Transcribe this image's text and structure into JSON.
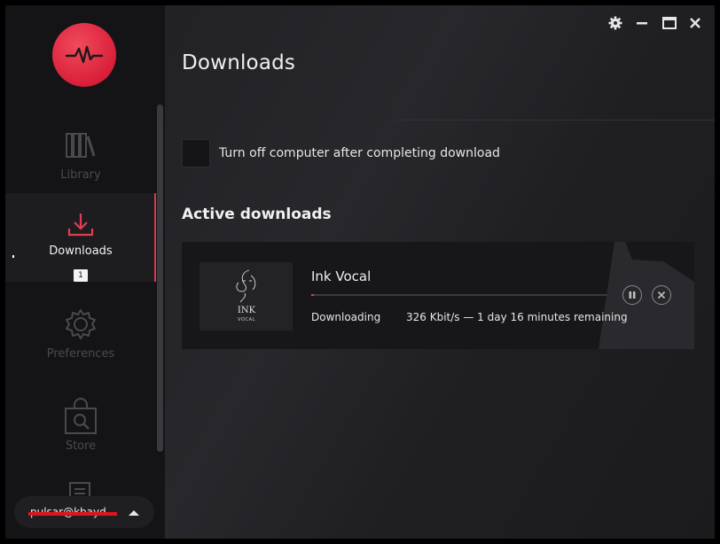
{
  "sidebar": {
    "items": [
      {
        "label": "Library",
        "icon": "books-icon"
      },
      {
        "label": "Downloads",
        "icon": "download-icon",
        "badge": "1",
        "active": true
      },
      {
        "label": "Preferences",
        "icon": "gear-icon"
      },
      {
        "label": "Store",
        "icon": "shopping-bag-icon"
      },
      {
        "label": "",
        "icon": "news-icon"
      }
    ],
    "user": {
      "name": "pulsar@kbayd"
    }
  },
  "main": {
    "title": "Downloads",
    "shutdown_option": {
      "label": "Turn off computer after completing download",
      "checked": false
    },
    "active_section_title": "Active downloads",
    "downloads": [
      {
        "name": "Ink Vocal",
        "cover_text": {
          "line1": "INK",
          "line2": "VOCAL"
        },
        "status": "Downloading",
        "speed_eta": "326 Kbit/s — 1 day 16 minutes remaining",
        "progress": 0.01
      }
    ]
  },
  "colors": {
    "accent": "#e23c52",
    "logo": "#d91f3a",
    "background": "#1b1b1d"
  }
}
